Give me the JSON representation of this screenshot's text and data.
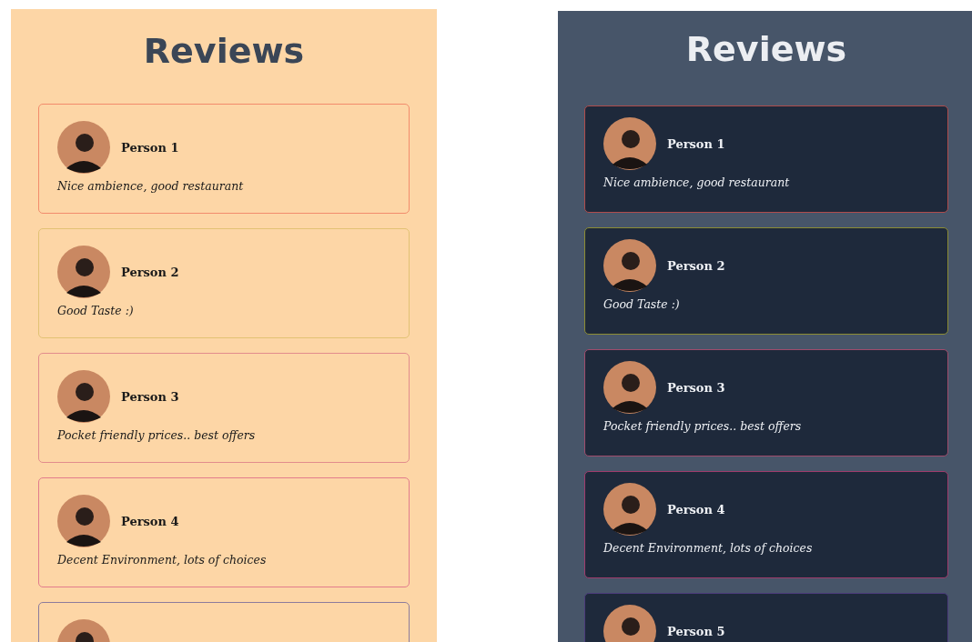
{
  "panels": [
    {
      "kind": "light",
      "title": "Reviews",
      "reviews": [
        {
          "name": "Person 1",
          "text": "Nice ambience, good restaurant",
          "color": "#f28c6c"
        },
        {
          "name": "Person 2",
          "text": "Good Taste :)",
          "color": "#e2c274"
        },
        {
          "name": "Person 3",
          "text": "Pocket friendly prices.. best offers",
          "color": "#e28c8c"
        },
        {
          "name": "Person 4",
          "text": "Decent Environment, lots of choices",
          "color": "#e27c8c"
        },
        {
          "color": "#8c7c9c"
        }
      ]
    },
    {
      "kind": "dark",
      "title": "Reviews",
      "reviews": [
        {
          "name": "Person 1",
          "text": "Nice ambience, good restaurant",
          "color": "#b04c4c"
        },
        {
          "name": "Person 2",
          "text": "Good Taste :)",
          "color": "#8c8c34"
        },
        {
          "name": "Person 3",
          "text": "Pocket friendly prices.. best offers",
          "color": "#a04c6c"
        },
        {
          "name": "Person 4",
          "text": "Decent Environment, lots of choices",
          "color": "#a03c6c"
        },
        {
          "name": "Person 5",
          "color": "#4c3c7c"
        }
      ]
    }
  ]
}
